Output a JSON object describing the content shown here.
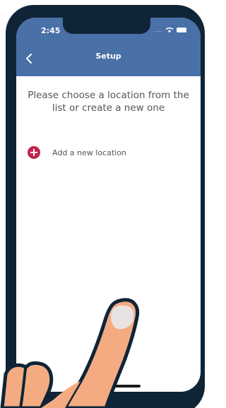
{
  "status_bar": {
    "time": "2:45",
    "signal_icon": "signal-dots",
    "wifi_icon": "wifi-icon",
    "battery_icon": "battery-icon"
  },
  "header": {
    "title": "Setup",
    "back_icon": "chevron-left-icon"
  },
  "main": {
    "prompt": "Please choose a location from the list or create a new one",
    "add_location": {
      "icon": "plus-circle-icon",
      "label": "Add a new location"
    }
  },
  "colors": {
    "appbar": "#4a70a8",
    "phone_frame": "#0f2436",
    "accent": "#c1234f",
    "text": "#555555",
    "hand_skin": "#f4ab82",
    "hand_outline": "#0f2436"
  }
}
